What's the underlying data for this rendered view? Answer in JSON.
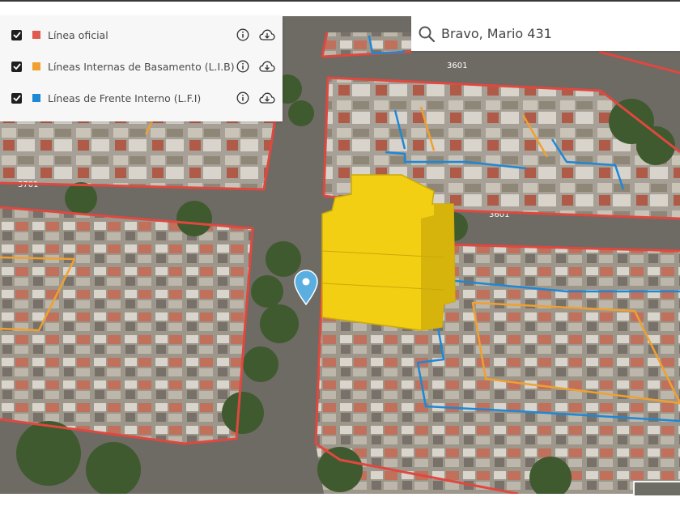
{
  "search": {
    "value": "Bravo, Mario 431"
  },
  "legend": {
    "items": [
      {
        "label": "Línea oficial",
        "color": "#e05a4f",
        "checked": true
      },
      {
        "label": "Líneas Internas de Basamento (L.I.B)",
        "color": "#f0a030",
        "checked": true
      },
      {
        "label": "Líneas de Frente Interno (L.F.I)",
        "color": "#1e88d6",
        "checked": true
      }
    ]
  },
  "map": {
    "street_labels": [
      "3701",
      "3601",
      "3601"
    ],
    "colors": {
      "official_line": "#e0483f",
      "basement_lines": "#f0a030",
      "front_lines": "#1e88d6",
      "building": "#f2cf12",
      "marker": "#5aaee0"
    }
  }
}
